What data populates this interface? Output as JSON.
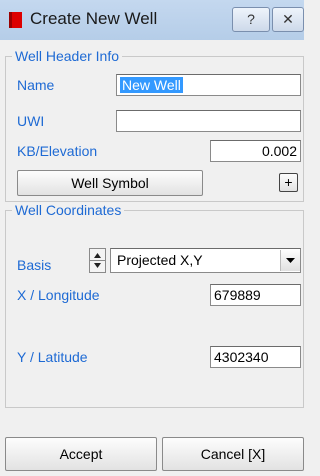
{
  "window": {
    "title": "Create New Well",
    "help_glyph": "?",
    "close_glyph": "✕"
  },
  "header_group": {
    "legend": "Well Header Info",
    "name_label": "Name",
    "name_value": "New Well",
    "uwi_label": "UWI",
    "uwi_value": "",
    "kb_label": "KB/Elevation",
    "kb_value": "0.002",
    "symbol_button": "Well Symbol",
    "plus_glyph": "+"
  },
  "coords_group": {
    "legend": "Well Coordinates",
    "basis_label": "Basis",
    "basis_value": "Projected X,Y",
    "x_label": "X / Longitude",
    "x_value": "679889",
    "y_label": "Y / Latitude",
    "y_value": "4302340"
  },
  "footer": {
    "accept": "Accept",
    "cancel": "Cancel [X]"
  }
}
